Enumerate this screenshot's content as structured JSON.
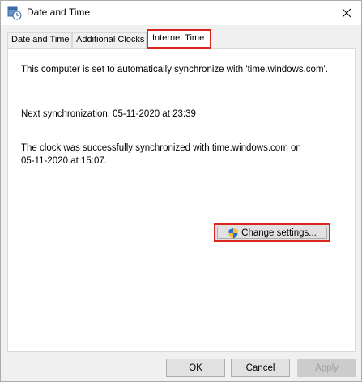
{
  "window": {
    "title": "Date and Time"
  },
  "tabs": [
    {
      "label": "Date and Time",
      "selected": false
    },
    {
      "label": "Additional Clocks",
      "selected": false
    },
    {
      "label": "Internet Time",
      "selected": true
    }
  ],
  "content": {
    "sync_status": "This computer is set to automatically synchronize with 'time.windows.com'.",
    "next_sync": "Next synchronization: 05-11-2020 at 23:39",
    "last_sync_line1": "The clock was successfully synchronized with time.windows.com on",
    "last_sync_line2": "05-11-2020 at 15:07."
  },
  "buttons": {
    "change_settings": "Change settings...",
    "ok": "OK",
    "cancel": "Cancel",
    "apply": "Apply"
  },
  "colors": {
    "highlight": "#d9251d",
    "disabled": "#a0a0a0"
  },
  "icons": {
    "title": "clock-calendar-icon",
    "shield": "uac-shield-icon",
    "close": "close-icon"
  }
}
